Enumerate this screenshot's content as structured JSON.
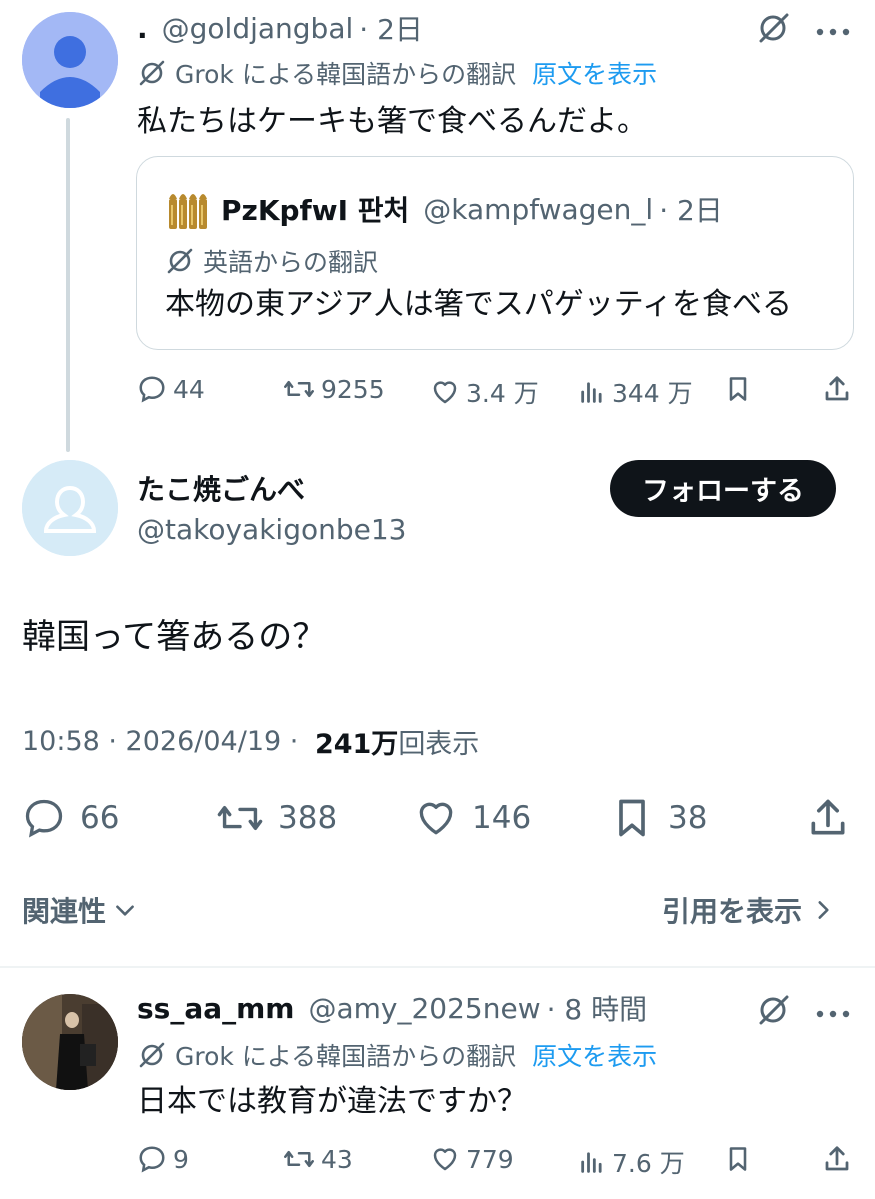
{
  "reply1": {
    "display_name": ".",
    "handle": "@goldjangbal",
    "time": "· 2日",
    "translation_label": "Grok による韓国語からの翻訳",
    "show_original": "原文を表示",
    "text": "私たちはケーキも箸で食べるんだよ。",
    "quote": {
      "display_name": "PzKpfwI 판처",
      "handle": "@kampfwagen_l",
      "time": "· 2日",
      "translation_label": "英語からの翻訳",
      "text": "本物の東アジア人は箸でスパゲッティを食べる"
    },
    "stats": {
      "replies": "44",
      "reposts": "9255",
      "likes": "3.4 万",
      "views": "344 万"
    }
  },
  "main_post": {
    "display_name": "たこ焼ごんべ",
    "handle": "@takoyakigonbe13",
    "follow_label": "フォローする",
    "text": "韓国って箸あるの？",
    "time_date": "10:58 · 2026/04/19 · ",
    "views_count": "241万",
    "views_label": "回表示",
    "stats": {
      "replies": "66",
      "reposts": "388",
      "likes": "146",
      "bookmarks": "38"
    }
  },
  "sort_bar": {
    "sort_label": "関連性",
    "quotes_label": "引用を表示"
  },
  "reply2": {
    "display_name": "ss_aa_mm",
    "handle": "@amy_2025new",
    "time": "· 8 時間",
    "translation_label": "Grok による韓国語からの翻訳",
    "show_original": "原文を表示",
    "text": "日本では教育が違法ですか？",
    "stats": {
      "replies": "9",
      "reposts": "43",
      "likes": "779",
      "views": "7.6 万"
    }
  },
  "colors": {
    "text": "#0f1419",
    "muted": "#536471",
    "link": "#1d9bf0",
    "border": "#cfd9de"
  }
}
